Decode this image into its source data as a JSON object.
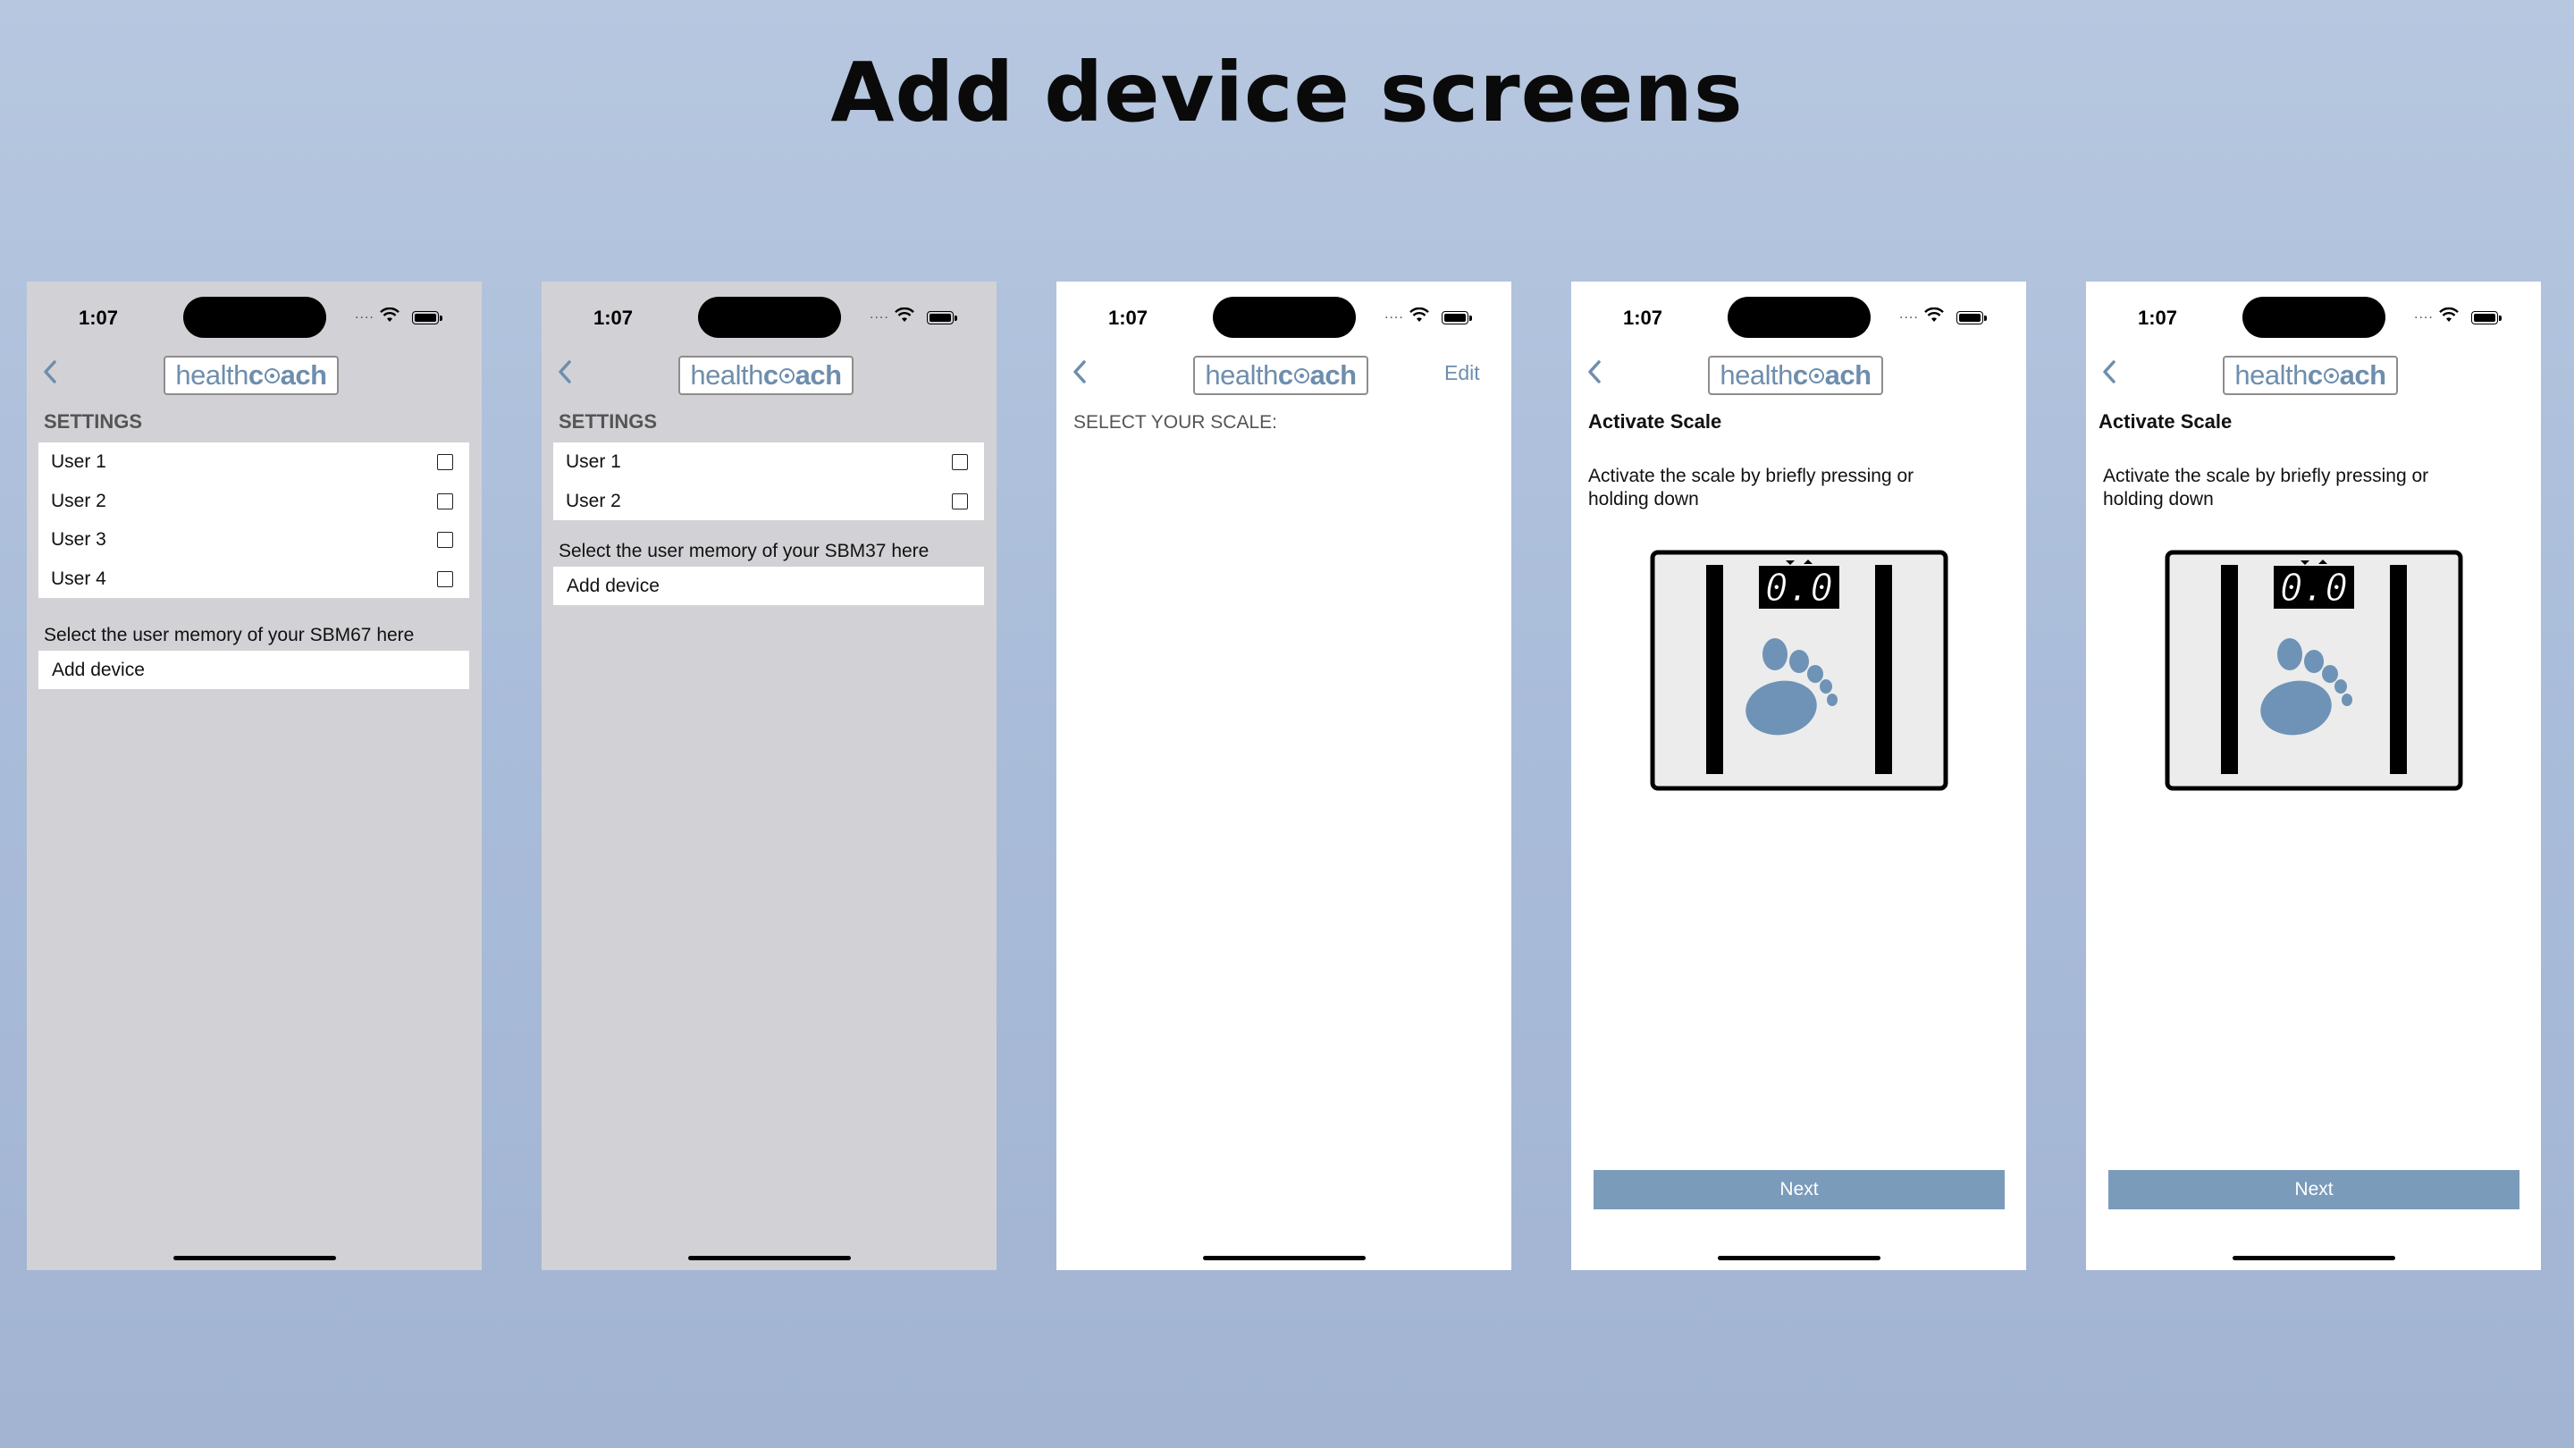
{
  "page": {
    "title": "Add device screens"
  },
  "colors": {
    "accent": "#7b9bbb",
    "logo_blue": "#6e8ead",
    "gray_bg": "#d2d2d6",
    "background": "#b0c2dc"
  },
  "status_bar": {
    "time": "1:07",
    "signal": "...."
  },
  "logo": {
    "part1": "health",
    "part2": "c",
    "part3": "ach"
  },
  "screen1": {
    "section": "SETTINGS",
    "users": [
      "User 1",
      "User 2",
      "User 3",
      "User 4"
    ],
    "hint": "Select the user memory of your SBM67 here",
    "add_device": "Add device"
  },
  "screen2": {
    "section": "SETTINGS",
    "users": [
      "User 1",
      "User 2"
    ],
    "hint": "Select the user memory of your SBM37 here",
    "add_device": "Add device"
  },
  "screen3": {
    "edit": "Edit",
    "select_label": "SELECT YOUR SCALE:"
  },
  "screen4": {
    "title": "Activate Scale",
    "text": "Activate the scale by briefly pressing or holding down",
    "display": "0.0",
    "next": "Next"
  },
  "screen5": {
    "title": "Activate Scale",
    "text": "Activate the scale by briefly pressing or holding down",
    "display": "0.0",
    "next": "Next"
  },
  "icons": [
    "back-chevron-icon",
    "wifi-icon",
    "battery-icon",
    "checkbox-icon",
    "scale-illustration",
    "foot-icon"
  ]
}
